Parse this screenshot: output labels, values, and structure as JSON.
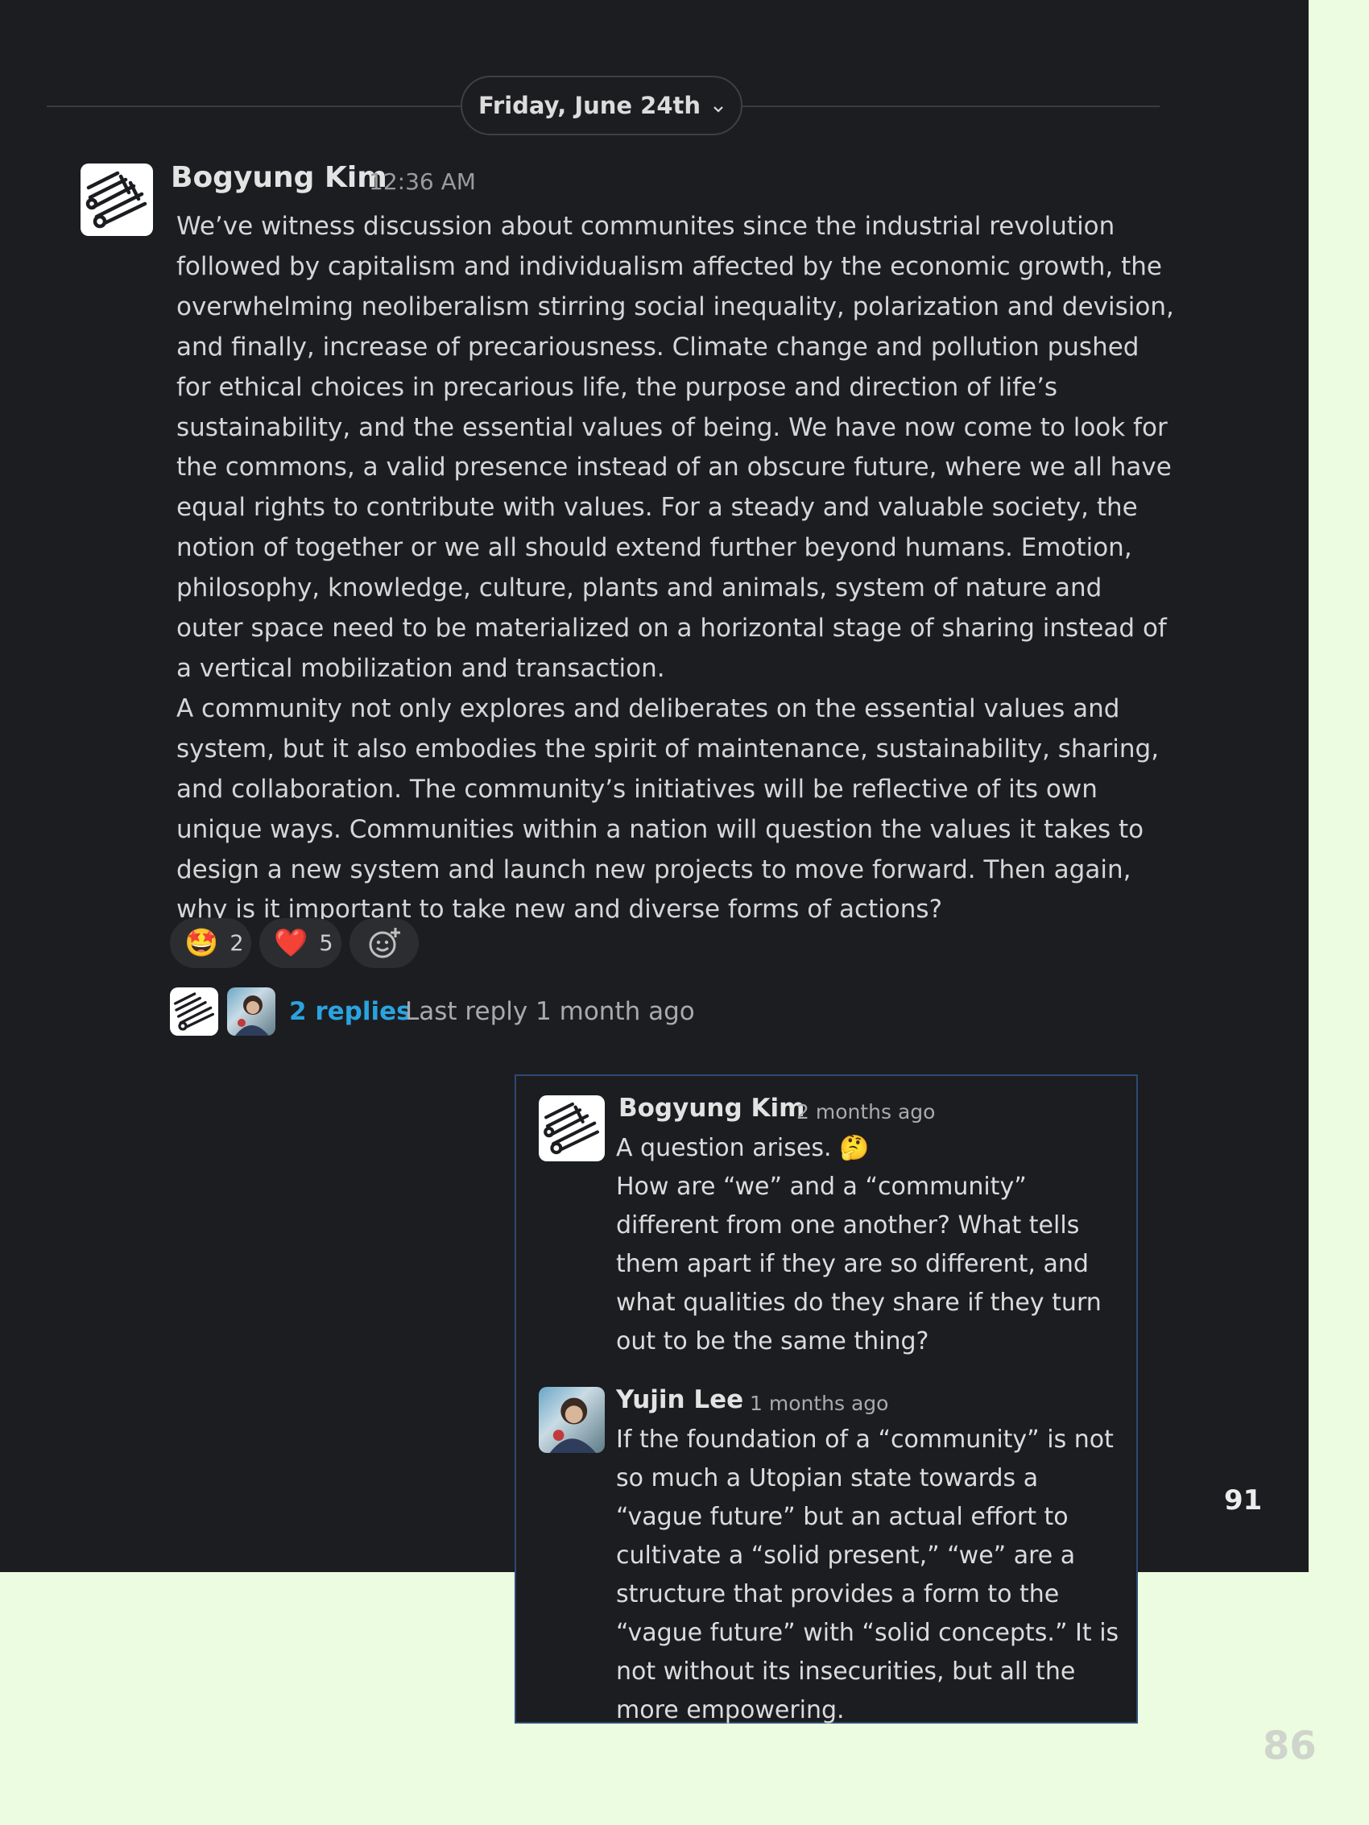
{
  "date_divider": {
    "label": "Friday, June 24th",
    "chevron_icon": "chevron-down-icon"
  },
  "message": {
    "author": "Bogyung Kim",
    "time": "12:36 AM",
    "paragraphs": [
      "We’ve witness discussion about communites since the industrial revolution followed by capitalism and individualism affected by the economic growth, the overwhelming neoliberalism stirring social inequality, polarization and devision, and finally, increase of precariousness. Climate change and pollution pushed for ethical choices in precarious life, the purpose and direction of life’s sustainability, and the essential values of being. We have now come to look for the commons, a valid presence instead of an obscure future, where we all have equal rights to contribute with values. For a steady and valuable society, the notion of together or we all should extend further beyond humans. Emotion, philosophy, knowledge, culture, plants and animals, system of nature and outer space need to be materialized on a horizontal stage of sharing instead of a vertical mobilization and transaction.",
      "A community not only explores and deliberates on the essential values and system, but it also embodies the spirit of maintenance, sustainability, sharing, and collaboration. The community’s initiatives will be reflective of its own unique ways. Communities within a nation will question the values it takes to design a new system and launch new projects to move forward. Then again, why is it important to take new and diverse forms of actions?"
    ]
  },
  "reactions": [
    {
      "emoji": "🤩",
      "count": "2"
    },
    {
      "emoji": "❤️",
      "count": "5"
    }
  ],
  "thread": {
    "replies_label": "2 replies",
    "last_reply": "Last reply 1 month ago"
  },
  "thread_replies": [
    {
      "author": "Bogyung Kim",
      "time": "2 months ago",
      "paragraphs": [
        "A question arises. 🤔",
        "How are “we” and a “community” different from one another? What tells them apart if they are so different, and what qualities do they share if they turn out to be the same thing?"
      ]
    },
    {
      "author": "Yujin Lee",
      "time": "1 months ago",
      "paragraphs": [
        "If the foundation of a “community” is not so much a Utopian state towards a “vague future” but an actual effort to cultivate a “solid present,” “we” are a structure that provides a form to the “vague future” with “solid concepts.” It is not without its insecurities, but all the more empowering."
      ]
    }
  ],
  "page_numbers": {
    "dark": "91",
    "light": "86"
  },
  "colors": {
    "background_dark": "#1c1d21",
    "background_light": "#ecfce0",
    "link": "#2aa3e0",
    "card_border": "#2b4b73"
  }
}
